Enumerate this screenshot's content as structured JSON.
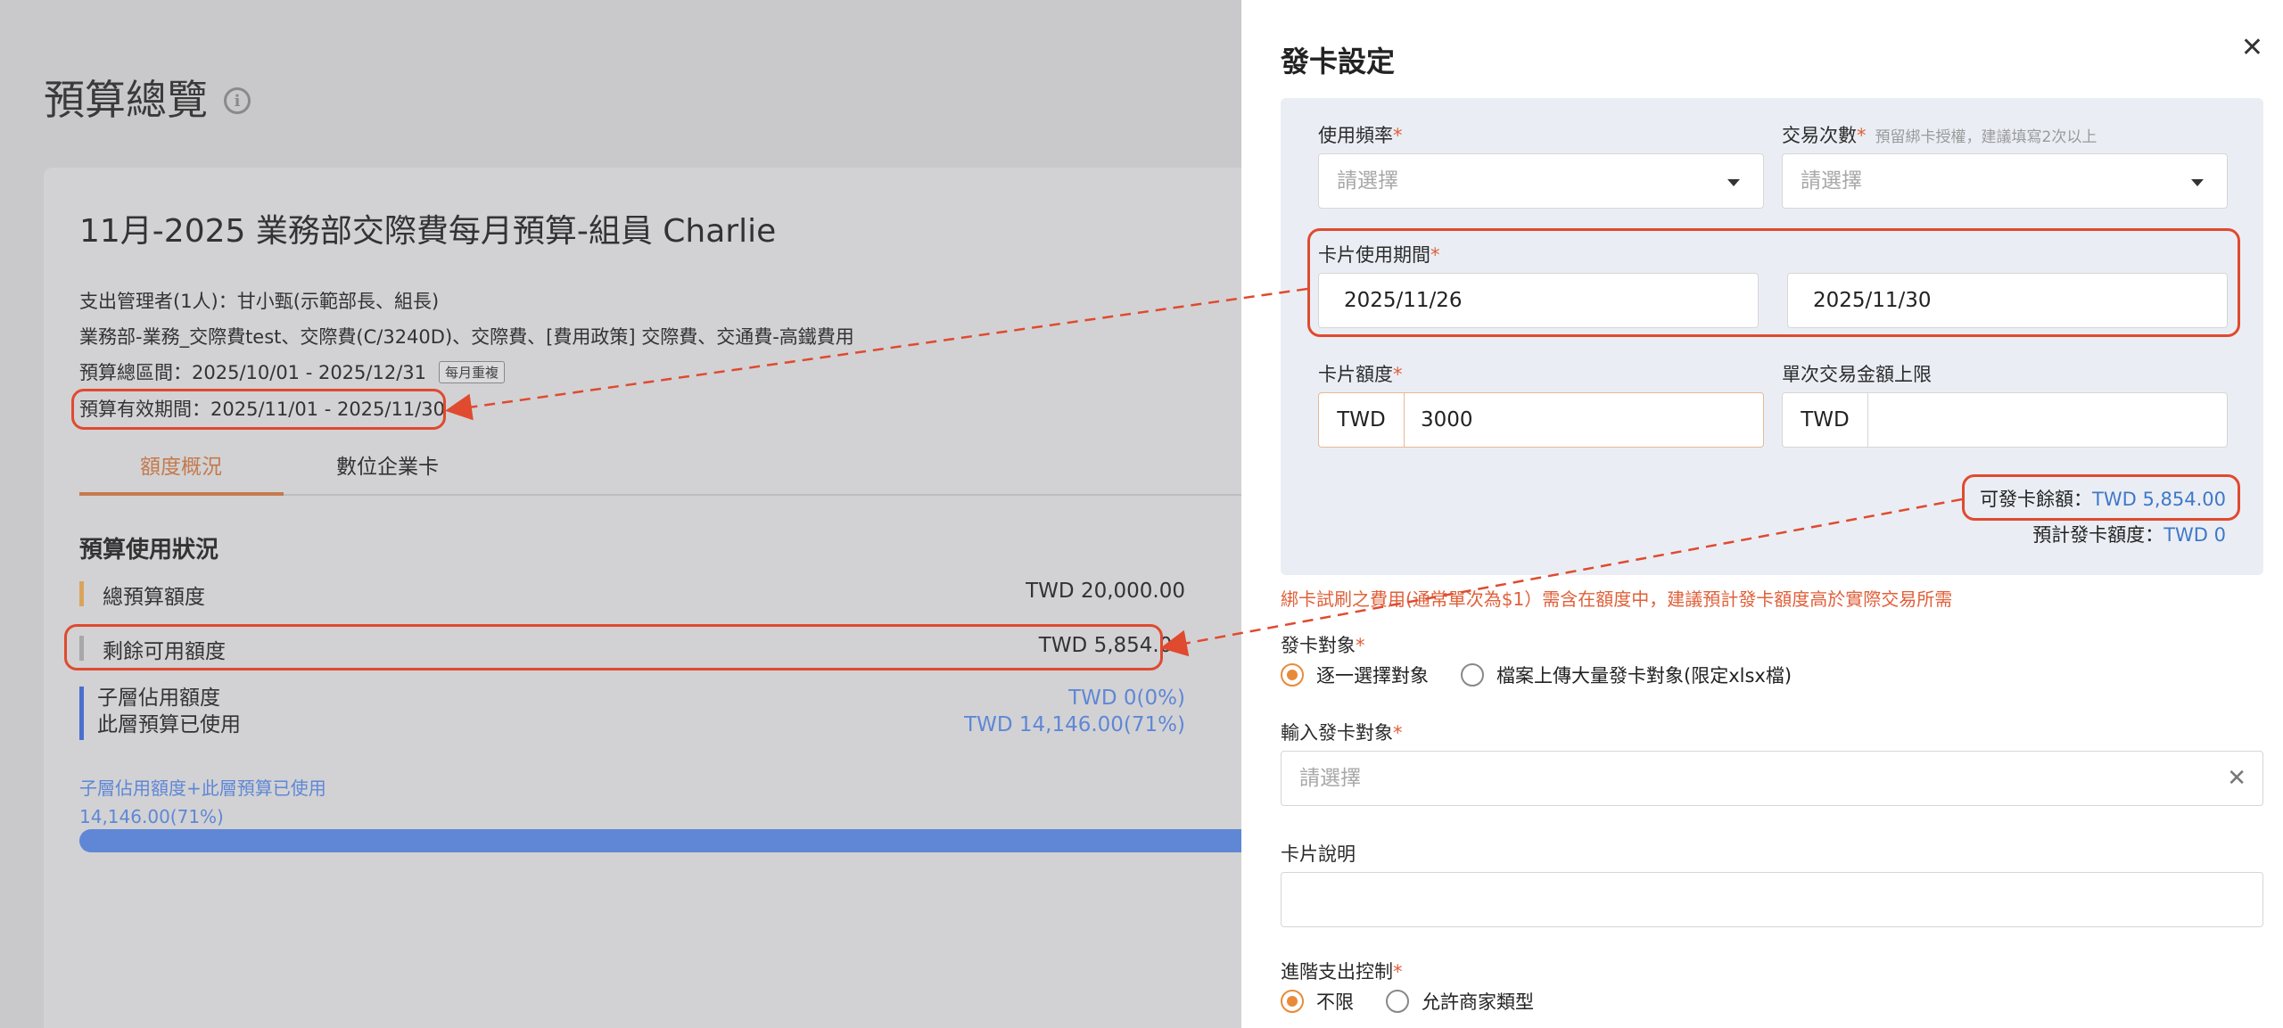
{
  "background_page": {
    "title": "預算總覽",
    "info_icon": "info-icon",
    "budget_title": "11月-2025 業務部交際費每月預算-組員 Charlie",
    "manager": "支出管理者(1人)：甘小甄(示範部長、組長)",
    "categories": "業務部-業務_交際費test、交際費(C/3240D)、交際費、[費用政策] 交際費、交通費-高鐵費用",
    "total_period": "預算總區間：2025/10/01 - 2025/12/31",
    "repeat_tag": "每月重複",
    "valid_period": "預算有效期間：2025/11/01 - 2025/11/30",
    "tabs": [
      {
        "label": "額度概況",
        "active": true
      },
      {
        "label": "數位企業卡",
        "active": false
      }
    ],
    "usage_title": "預算使用狀況",
    "total_budget": {
      "label": "總預算額度",
      "value": "TWD 20,000.00"
    },
    "remaining": {
      "label": "剩餘可用額度",
      "value": "TWD 5,854.00"
    },
    "child_used": {
      "label": "子層佔用額度",
      "value": "TWD 0(0%)"
    },
    "layer_used": {
      "label": "此層預算已使用",
      "value": "TWD 14,146.00(71%)"
    },
    "sum_label": "子層佔用額度+此層預算已使用",
    "sum_value": "14,146.00(71%)",
    "progress_percent": 71
  },
  "drawer": {
    "title": "發卡設定",
    "close_icon": "close-icon",
    "frequency": {
      "label": "使用頻率",
      "placeholder": "請選擇"
    },
    "transactions": {
      "label": "交易次數",
      "hint": "預留綁卡授權，建議填寫2次以上",
      "placeholder": "請選擇"
    },
    "period": {
      "label": "卡片使用期間",
      "start": "2025/11/26",
      "separator": "-",
      "end": "2025/11/30"
    },
    "card_limit": {
      "label": "卡片額度",
      "currency": "TWD",
      "amount": "3000"
    },
    "single_limit": {
      "label": "單次交易金額上限",
      "currency": "TWD",
      "amount": ""
    },
    "available": {
      "label": "可發卡餘額：",
      "value": "TWD 5,854.00"
    },
    "estimated": {
      "label": "預計發卡額度：",
      "value": "TWD 0"
    },
    "warning": "綁卡試刷之費用(通常單次為$1）需含在額度中，建議預計發卡額度高於實際交易所需",
    "target": {
      "label": "發卡對象",
      "options": [
        {
          "label": "逐一選擇對象",
          "selected": true
        },
        {
          "label": "檔案上傳大量發卡對象(限定xlsx檔)",
          "selected": false
        }
      ]
    },
    "target_input": {
      "label": "輸入發卡對象",
      "placeholder": "請選擇"
    },
    "description": {
      "label": "卡片說明",
      "value": ""
    },
    "advanced": {
      "label": "進階支出控制",
      "options": [
        {
          "label": "不限",
          "selected": true
        },
        {
          "label": "允許商家類型",
          "selected": false
        }
      ]
    }
  },
  "colors": {
    "annotation": "#e04a2f",
    "accent": "#e88a3a",
    "link": "#3f78c9"
  }
}
